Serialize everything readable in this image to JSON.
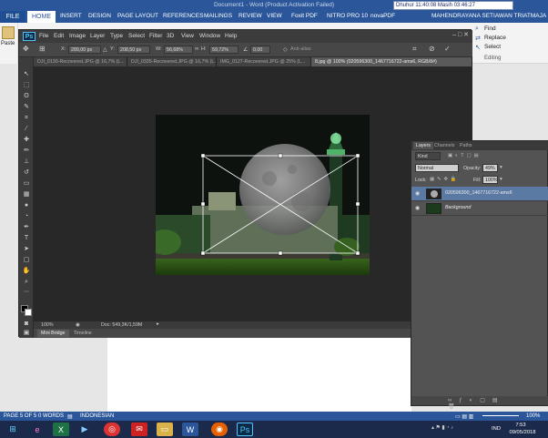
{
  "word": {
    "title": "Document1 - Word (Product Activation Failed)",
    "tabs": [
      "FILE",
      "HOME",
      "INSERT",
      "DESIGN",
      "PAGE LAYOUT",
      "REFERENCES",
      "MAILINGS",
      "REVIEW",
      "VIEW",
      "Foxit PDF",
      "NITRO PRO 10",
      "novaPDF"
    ],
    "clock_text": "Dhuhur 11:40:08  Masih 03:46:27",
    "user": "MAHENDRAYANA SETIAWAN TRIATMAJA",
    "paste_label": "Paste",
    "editing": {
      "find": "Find",
      "replace": "Replace",
      "select": "Select",
      "group_label": "Editing"
    },
    "status": {
      "page": "PAGE 5 OF 5",
      "words": "0 WORDS",
      "language": "INDONESIAN",
      "zoom": "100%"
    }
  },
  "ps": {
    "logo": "Ps",
    "menus": [
      "File",
      "Edit",
      "Image",
      "Layer",
      "Type",
      "Select",
      "Filter",
      "3D",
      "View",
      "Window",
      "Help"
    ],
    "options": {
      "x_label": "X:",
      "x_value": "289,00 px",
      "y_label": "Y:",
      "y_value": "208,50 px",
      "w_label": "W:",
      "w_value": "56,68%",
      "h_label": "H:",
      "h_value": "59,72%",
      "angle_value": "0,00",
      "antialias": "Anti-alias"
    },
    "doc_tabs": [
      "DJI_0130-Recovered.JPG @ 16,7% (L...",
      "DJI_0335-Recovered.JPG @ 16,7% (L...",
      "IMG_0127-Recovered.JPG @ 25% (L...",
      "8.jpg @ 100% (020596300_1467716722-ams6, RGB/8#)"
    ],
    "status": {
      "zoom": "100%",
      "doc": "Doc: 549,3K/1,59M"
    },
    "bottom_tabs": [
      "Mini Bridge",
      "Timeline"
    ]
  },
  "layers": {
    "tabs": [
      "Layers",
      "Channels",
      "Paths"
    ],
    "kind_label": "Kind",
    "blend_mode": "Normal",
    "opacity_label": "Opacity:",
    "opacity_value": "49%",
    "lock_label": "Lock:",
    "fill_label": "Fill:",
    "fill_value": "100%",
    "items": [
      {
        "name": "020596300_1467716722-ams6",
        "selected": true
      },
      {
        "name": "Background",
        "selected": false
      }
    ]
  },
  "tray": {
    "lang": "IND",
    "time": "7:53",
    "date": "09/05/2018"
  }
}
